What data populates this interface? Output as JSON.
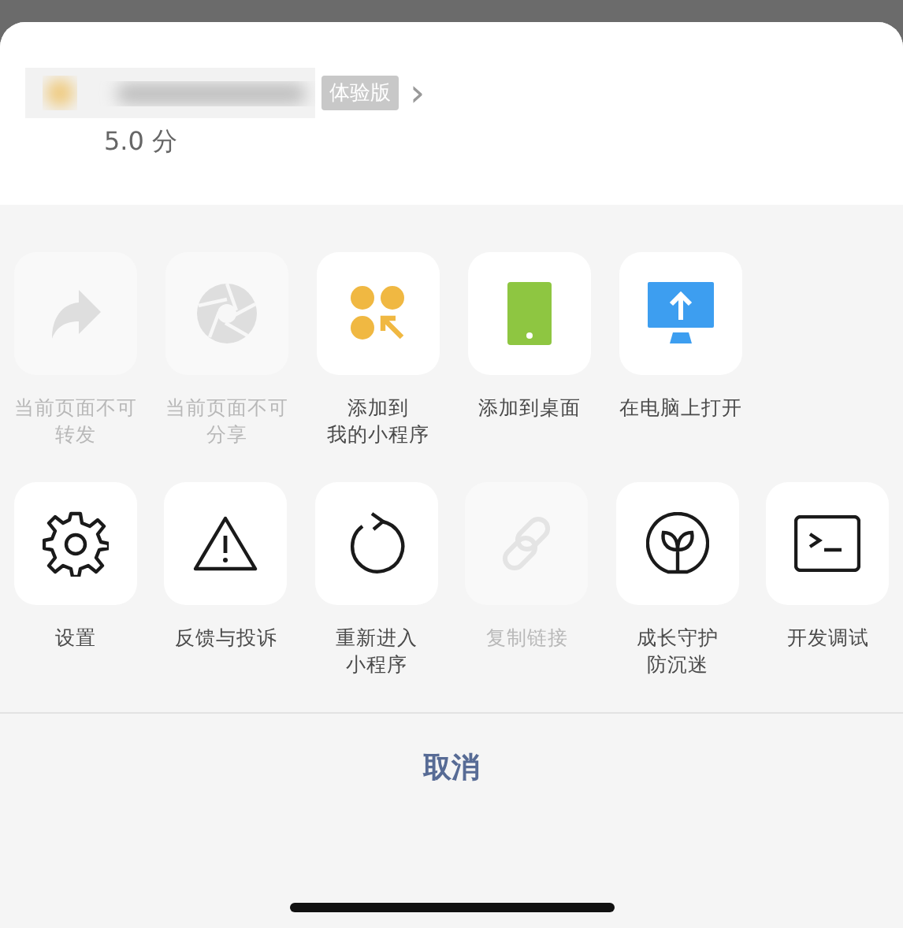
{
  "header": {
    "badge": "体验版",
    "chevron": "›",
    "rating": "5.0 分"
  },
  "action_rows": [
    [
      {
        "label_lines": [
          "当前页面不可",
          "转发"
        ],
        "disabled": true
      },
      {
        "label_lines": [
          "当前页面不可",
          "分享"
        ],
        "disabled": true
      },
      {
        "label_lines": [
          "添加到",
          "我的小程序"
        ],
        "disabled": false
      },
      {
        "label_lines": [
          "添加到桌面"
        ],
        "disabled": false
      },
      {
        "label_lines": [
          "在电脑上打开"
        ],
        "disabled": false
      }
    ],
    [
      {
        "label_lines": [
          "设置"
        ],
        "disabled": false
      },
      {
        "label_lines": [
          "反馈与投诉"
        ],
        "disabled": false
      },
      {
        "label_lines": [
          "重新进入",
          "小程序"
        ],
        "disabled": false
      },
      {
        "label_lines": [
          "复制链接"
        ],
        "disabled": true
      },
      {
        "label_lines": [
          "成长守护",
          "防沉迷"
        ],
        "disabled": false
      },
      {
        "label_lines": [
          "开发调试"
        ],
        "disabled": false
      }
    ]
  ],
  "cancel": "取消"
}
